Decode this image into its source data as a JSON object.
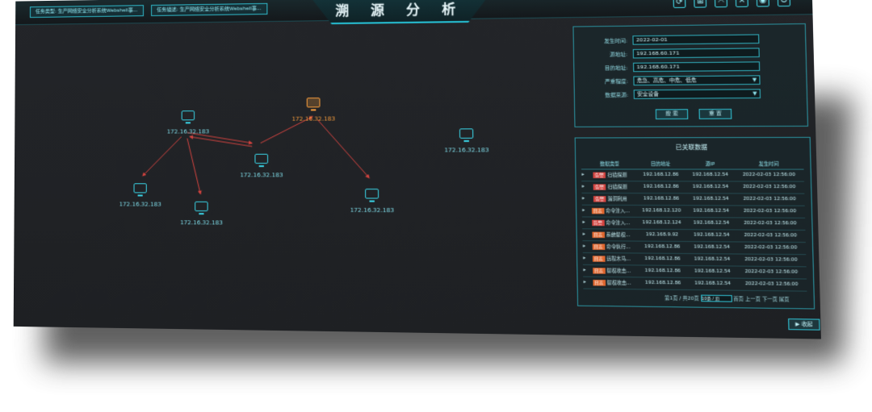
{
  "header": {
    "title": "溯 源 分 析",
    "alerts": [
      "任务类型: 生产网络安全分析系统Webshell事...",
      "任务描述: 生产网络安全分析系统Webshell事..."
    ],
    "toolbar_icons": [
      "refresh-icon",
      "grid-icon",
      "expand-icon",
      "trash-icon",
      "eye-icon",
      "power-icon"
    ]
  },
  "graph": {
    "nodes": [
      {
        "id": "n1",
        "label": "172.16.32.183",
        "alert": false
      },
      {
        "id": "n2",
        "label": "172.16.32.183",
        "alert": true
      },
      {
        "id": "n3",
        "label": "172.16.32.183",
        "alert": false
      },
      {
        "id": "n4",
        "label": "172.16.32.183",
        "alert": false
      },
      {
        "id": "n5",
        "label": "172.16.32.183",
        "alert": false
      },
      {
        "id": "n6",
        "label": "172.16.32.183",
        "alert": false
      },
      {
        "id": "n7",
        "label": "172.16.32.183",
        "alert": false
      }
    ],
    "edge_color": "#d2433f"
  },
  "filter": {
    "rows": [
      {
        "label": "发生时间:",
        "value": "2022-02-01",
        "select": false
      },
      {
        "label": "源地址:",
        "value": "192.168.60.171",
        "select": false
      },
      {
        "label": "目的地址:",
        "value": "192.168.60.171",
        "select": false
      },
      {
        "label": "严重程度:",
        "value": "危急、高危、中危、低危",
        "select": true
      },
      {
        "label": "数据来源:",
        "value": "安全设备",
        "select": true
      }
    ],
    "search_label": "搜 索",
    "reset_label": "重 置"
  },
  "related": {
    "title": "已关联数据",
    "columns": [
      "",
      "数据类型",
      "目的地址",
      "源IP",
      "发生时间"
    ],
    "rows": [
      {
        "tag": "告警",
        "tag_color": "#d2433f",
        "type": "扫描探测",
        "dst": "192.168.12.86",
        "src": "192.168.12.54",
        "time": "2022-02-03 12:56:00"
      },
      {
        "tag": "告警",
        "tag_color": "#d2433f",
        "type": "扫描探测",
        "dst": "192.168.12.86",
        "src": "192.168.12.54",
        "time": "2022-02-03 12:56:00"
      },
      {
        "tag": "告警",
        "tag_color": "#d2433f",
        "type": "漏洞利用",
        "dst": "192.168.12.86",
        "src": "192.168.12.54",
        "time": "2022-02-03 12:56:00"
      },
      {
        "tag": "日志",
        "tag_color": "#e0662e",
        "type": "命令注入...",
        "dst": "192.168.12.120",
        "src": "192.168.12.54",
        "time": "2022-02-03 12:56:00"
      },
      {
        "tag": "告警",
        "tag_color": "#d2433f",
        "type": "命令注入...",
        "dst": "192.168.12.124",
        "src": "192.168.12.54",
        "time": "2022-02-03 12:56:00"
      },
      {
        "tag": "日志",
        "tag_color": "#e0662e",
        "type": "系统提权...",
        "dst": "192.168.9.92",
        "src": "192.168.12.54",
        "time": "2022-02-03 12:56:00"
      },
      {
        "tag": "日志",
        "tag_color": "#e0662e",
        "type": "命令执行...",
        "dst": "192.168.12.86",
        "src": "192.168.12.54",
        "time": "2022-02-03 12:56:00"
      },
      {
        "tag": "日志",
        "tag_color": "#e0662e",
        "type": "远程木马...",
        "dst": "192.168.12.86",
        "src": "192.168.12.54",
        "time": "2022-02-03 12:56:00"
      },
      {
        "tag": "日志",
        "tag_color": "#e0662e",
        "type": "提权攻击...",
        "dst": "192.168.12.86",
        "src": "192.168.12.54",
        "time": "2022-02-03 12:56:00"
      },
      {
        "tag": "日志",
        "tag_color": "#e0662e",
        "type": "提权攻击...",
        "dst": "192.168.12.86",
        "src": "192.168.12.54",
        "time": "2022-02-03 12:56:00"
      }
    ],
    "pager": "第1页 / 共20页",
    "page_size": "10条 / 页",
    "first": "首页",
    "prev": "上一页",
    "next": "下一页",
    "last": "尾页"
  },
  "collapse_label": "收起"
}
